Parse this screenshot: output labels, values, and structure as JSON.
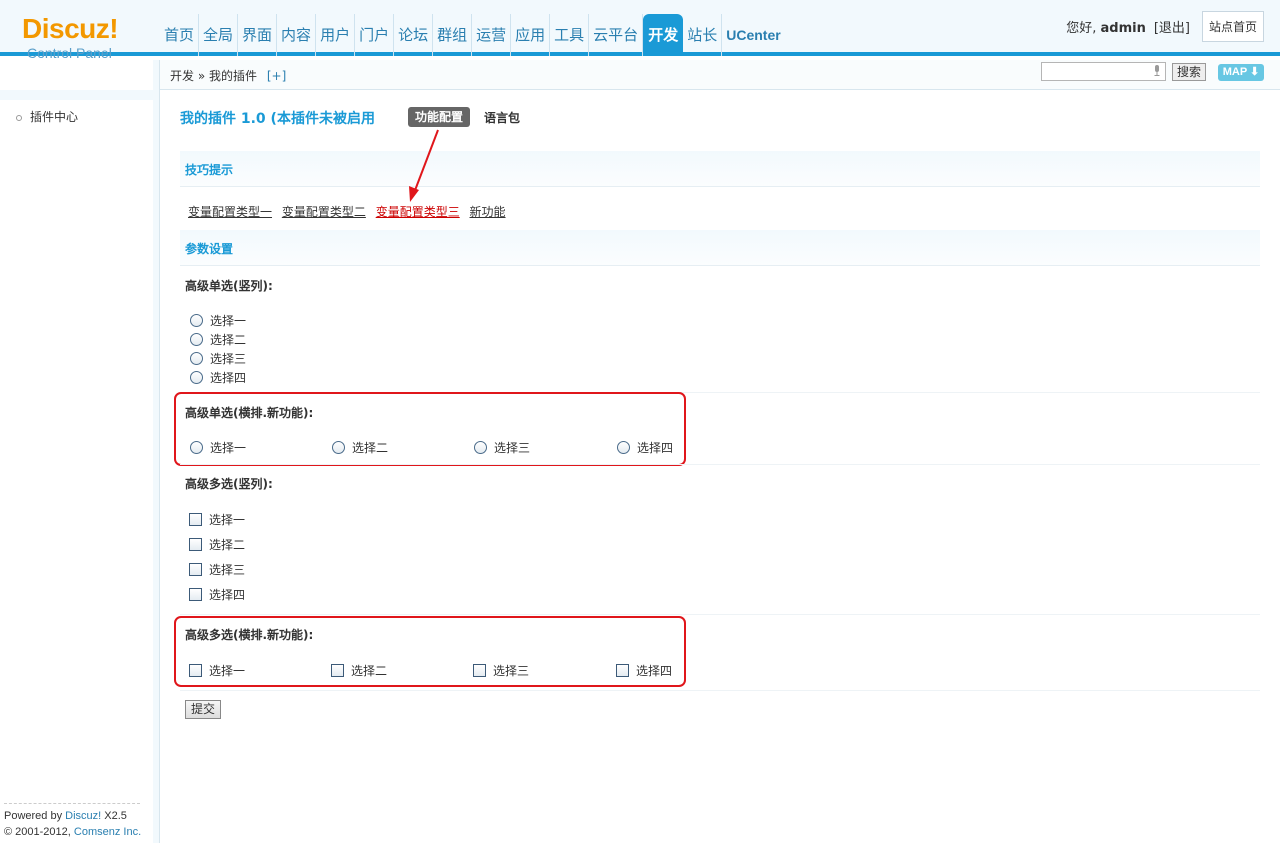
{
  "logo": {
    "main": "Discuz!",
    "sub": "Control Panel"
  },
  "nav": [
    {
      "label": "首页"
    },
    {
      "label": "全局"
    },
    {
      "label": "界面"
    },
    {
      "label": "内容"
    },
    {
      "label": "用户"
    },
    {
      "label": "门户"
    },
    {
      "label": "论坛"
    },
    {
      "label": "群组"
    },
    {
      "label": "运营"
    },
    {
      "label": "应用"
    },
    {
      "label": "工具"
    },
    {
      "label": "云平台"
    },
    {
      "label": "开发",
      "active": true
    },
    {
      "label": "站长"
    },
    {
      "label": "UCenter"
    }
  ],
  "topbar": {
    "greeting": "您好,",
    "username": "admin",
    "logout": "[退出]",
    "home": "站点首页"
  },
  "subbar": {
    "crumb_1": "开发",
    "crumb_sep": "»",
    "crumb_2": "我的插件",
    "add": "[+]",
    "search_value": "",
    "search_button": "搜索",
    "map_button": "MAP"
  },
  "sidebar": {
    "item": "插件中心",
    "powered_prefix": "Powered by ",
    "powered_link": "Discuz!",
    "version": " X2.5",
    "copyright_prefix": "© 2001-2012, ",
    "copyright_link": "Comsenz Inc."
  },
  "main": {
    "title": "我的插件 1.0 (本插件未被启用",
    "tab_config": "功能配置",
    "tab_lang": "语言包",
    "tips_head": "技巧提示",
    "tips_links": [
      "变量配置类型一",
      "变量配置类型二",
      "变量配置类型三",
      "新功能"
    ],
    "tips_current_index": 2,
    "params_head": "参数设置",
    "radio_vertical": {
      "label": "高级单选(竖列):",
      "options": [
        "选择一",
        "选择二",
        "选择三",
        "选择四"
      ]
    },
    "radio_horizontal": {
      "label": "高级单选(横排.新功能):",
      "options": [
        "选择一",
        "选择二",
        "选择三",
        "选择四"
      ]
    },
    "check_vertical": {
      "label": "高级多选(竖列):",
      "options": [
        "选择一",
        "选择二",
        "选择三",
        "选择四"
      ]
    },
    "check_horizontal": {
      "label": "高级多选(横排.新功能):",
      "options": [
        "选择一",
        "选择二",
        "选择三",
        "选择四"
      ]
    },
    "submit": "提交"
  },
  "colors": {
    "accent": "#1a9ad6",
    "logo": "#f39800",
    "highlight": "#e0161b",
    "current_link": "#cc0000"
  }
}
